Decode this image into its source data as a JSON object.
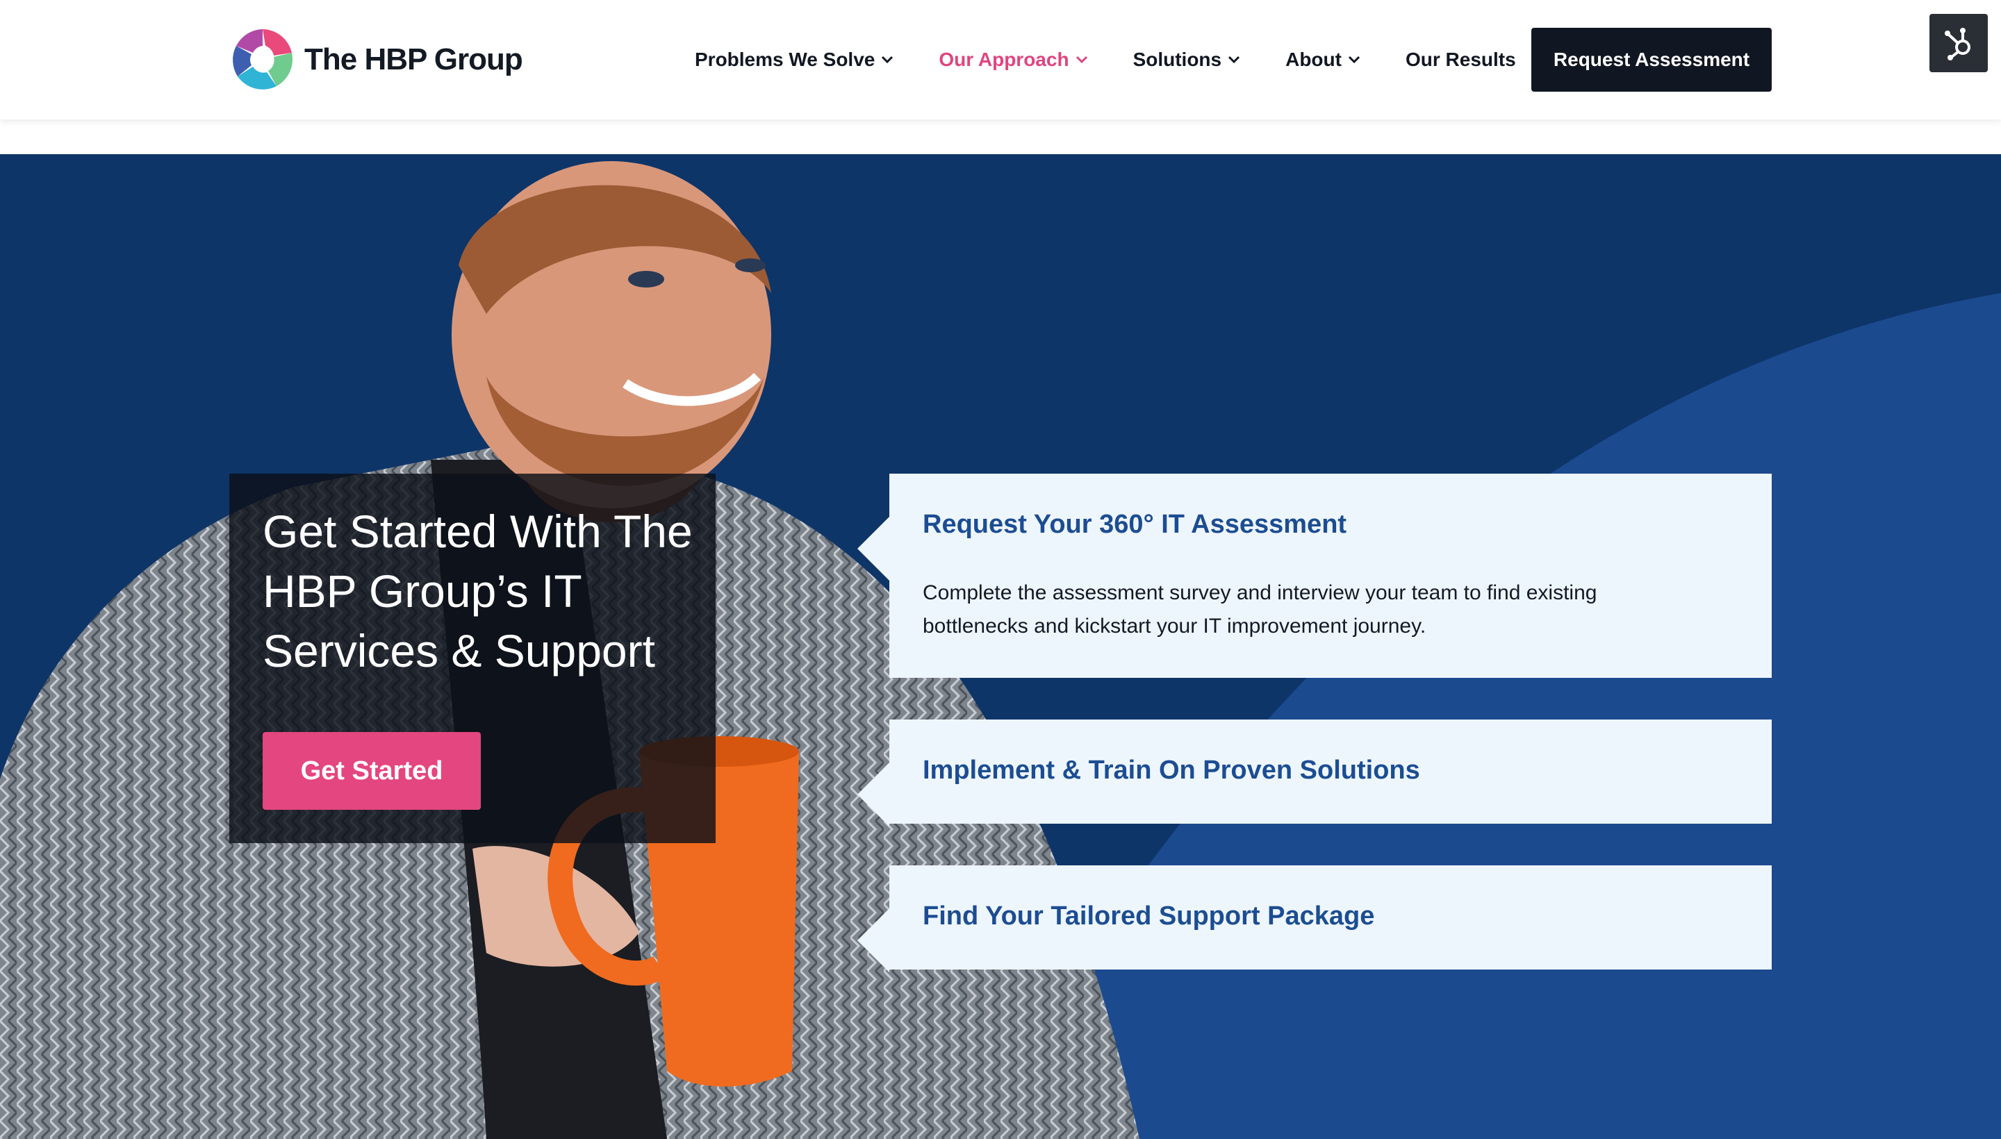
{
  "header": {
    "logo_text": "The HBP Group",
    "nav": [
      {
        "label": "Problems We Solve",
        "has_dropdown": true,
        "active": false
      },
      {
        "label": "Our Approach",
        "has_dropdown": true,
        "active": true
      },
      {
        "label": "Solutions",
        "has_dropdown": true,
        "active": false
      },
      {
        "label": "About",
        "has_dropdown": true,
        "active": false
      },
      {
        "label": "Our Results",
        "has_dropdown": false,
        "active": false
      }
    ],
    "cta_label": "Request Assessment",
    "hubspot_icon": "hubspot-icon"
  },
  "hero": {
    "title": "Get Started With The HBP Group’s IT Services & Support",
    "button_label": "Get Started",
    "cards": [
      {
        "title": "Request Your 360° IT Assessment",
        "text": "Complete the assessment survey and interview your team to find existing bottlenecks and kickstart your IT improvement journey."
      },
      {
        "title": "Implement & Train On Proven Solutions"
      },
      {
        "title": "Find Your Tailored Support Package"
      }
    ]
  },
  "colors": {
    "brand_pink": "#e4467f",
    "navy": "#0e3568",
    "card_blue_text": "#1c4d92",
    "dark": "#111722"
  }
}
